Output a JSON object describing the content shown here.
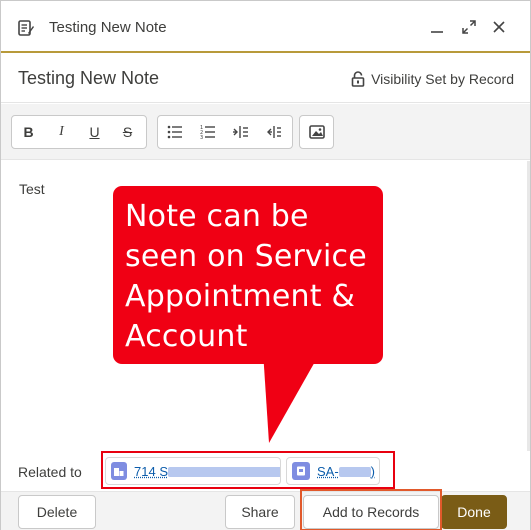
{
  "header": {
    "title": "Testing New Note",
    "minimize_icon": "minimize-icon",
    "expand_icon": "expand-icon",
    "close_icon": "close-icon"
  },
  "note": {
    "title": "Testing New Note",
    "visibility": "Visibility Set by Record",
    "body": "Test"
  },
  "toolbar": {
    "buttons": [
      "bold",
      "italic",
      "underline",
      "strikethrough",
      "bulleted-list",
      "numbered-list",
      "indent",
      "outdent",
      "image"
    ]
  },
  "callout": {
    "text": "Note can be seen on Service Appointment & Account"
  },
  "related": {
    "label": "Related to",
    "records": [
      {
        "type": "account",
        "text": "714 S",
        "icon_color": "#7f8de1"
      },
      {
        "type": "service-appointment",
        "text": "SA-",
        "icon_color": "#7f8de1"
      }
    ]
  },
  "footer": {
    "delete": "Delete",
    "share": "Share",
    "add_to_records": "Add to Records",
    "done": "Done"
  },
  "colors": {
    "accent": "#b89a3a",
    "done_button": "#7a5c16",
    "callout": "#f00014",
    "highlight_red": "#e8000f",
    "highlight_orange": "#e1592b"
  }
}
